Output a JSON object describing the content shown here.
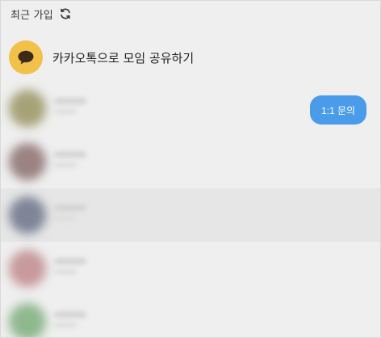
{
  "header": {
    "title": "최근 가입",
    "refresh_icon": "refresh-icon"
  },
  "share": {
    "label": "카카오톡으로 모임 공유하기",
    "icon": "speech-bubble-icon",
    "icon_bg": "#f2c14a"
  },
  "inquiry": {
    "label": "1:1 문의",
    "bg": "#4a9bea"
  },
  "members": [
    {
      "avatar_color": "#a6a278"
    },
    {
      "avatar_color": "#9a8382"
    },
    {
      "avatar_color": "#7f8597"
    },
    {
      "avatar_color": "#c79a9c"
    },
    {
      "avatar_color": "#8fb88f"
    }
  ]
}
